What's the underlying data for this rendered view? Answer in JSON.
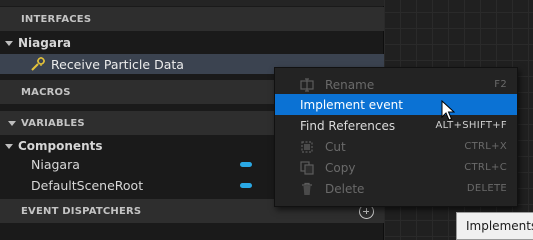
{
  "panel": {
    "sections": {
      "interfaces": "INTERFACES",
      "macros": "MACROS",
      "variables": "VARIABLES",
      "event_dispatchers": "EVENT DISPATCHERS"
    },
    "interfaces": {
      "category": "Niagara",
      "items": [
        {
          "label": "Receive Particle Data",
          "icon": "interface-function-icon"
        }
      ]
    },
    "variables": {
      "category": "Components",
      "items": [
        {
          "label": "Niagara",
          "color": "#2aa8e4"
        },
        {
          "label": "DefaultSceneRoot",
          "color": "#2aa8e4"
        }
      ]
    }
  },
  "context_menu": {
    "items": [
      {
        "label": "Rename",
        "shortcut": "F2",
        "enabled": false,
        "icon": "rename-icon"
      },
      {
        "label": "Implement event",
        "shortcut": "",
        "enabled": true,
        "hovered": true
      },
      {
        "label": "Find References",
        "shortcut": "ALT+SHIFT+F",
        "enabled": true
      },
      {
        "label": "Cut",
        "shortcut": "CTRL+X",
        "enabled": false,
        "icon": "cut-icon"
      },
      {
        "label": "Copy",
        "shortcut": "CTRL+C",
        "enabled": false,
        "icon": "copy-icon"
      },
      {
        "label": "Delete",
        "shortcut": "DELETE",
        "enabled": false,
        "icon": "delete-icon"
      }
    ]
  },
  "tooltip": {
    "text": "Implements t"
  },
  "colors": {
    "selection": "#3b4350",
    "menu_highlight": "#0b72d4",
    "variable_pill": "#2aa8e4"
  }
}
